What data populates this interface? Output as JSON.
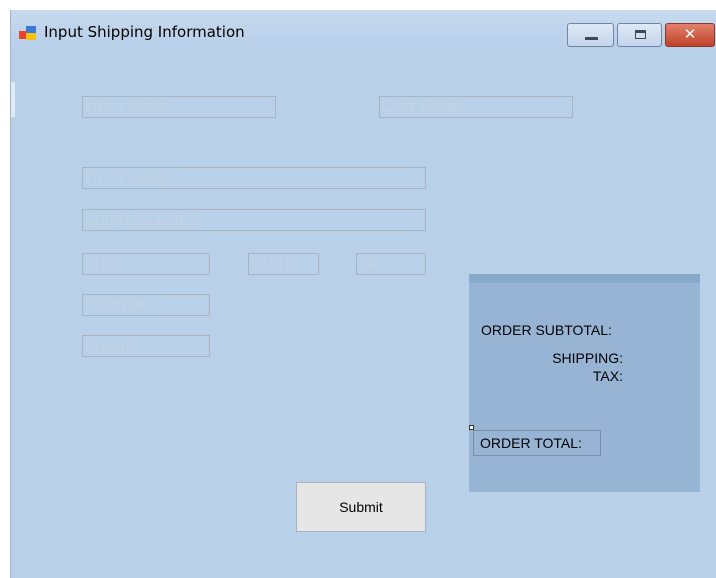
{
  "window": {
    "title": "Input Shipping Information",
    "close_glyph": "✕",
    "icons": {
      "app": "app-icon",
      "minimize": "minimize-icon",
      "maximize": "maximize-icon",
      "close": "close-icon"
    }
  },
  "form": {
    "first_name": {
      "placeholder": "FIRST NAME",
      "value": ""
    },
    "last_name": {
      "placeholder": "LAST NAME",
      "value": ""
    },
    "address_line_1": {
      "placeholder": "FIRST NAME",
      "value": ""
    },
    "address_line_2": {
      "placeholder": "ADDRESS LINE 2",
      "value": ""
    },
    "city": {
      "placeholder": "CITY",
      "value": ""
    },
    "state": {
      "placeholder": "STATE",
      "value": ""
    },
    "zip": {
      "placeholder": "ZIP",
      "value": ""
    },
    "country": {
      "placeholder": "COUNTRY",
      "value": ""
    },
    "phone": {
      "placeholder": "PHONE",
      "value": ""
    },
    "submit_label": "Submit"
  },
  "summary": {
    "subtotal_label": "ORDER SUBTOTAL:",
    "shipping_label": "SHIPPING:",
    "tax_label": "TAX:",
    "total_label": "ORDER TOTAL:"
  },
  "colors": {
    "window_bg": "#b8d0e8",
    "panel_bg": "#97b4d5",
    "close_button": "#c0412b",
    "placeholder_text": "#c6d3e2"
  }
}
